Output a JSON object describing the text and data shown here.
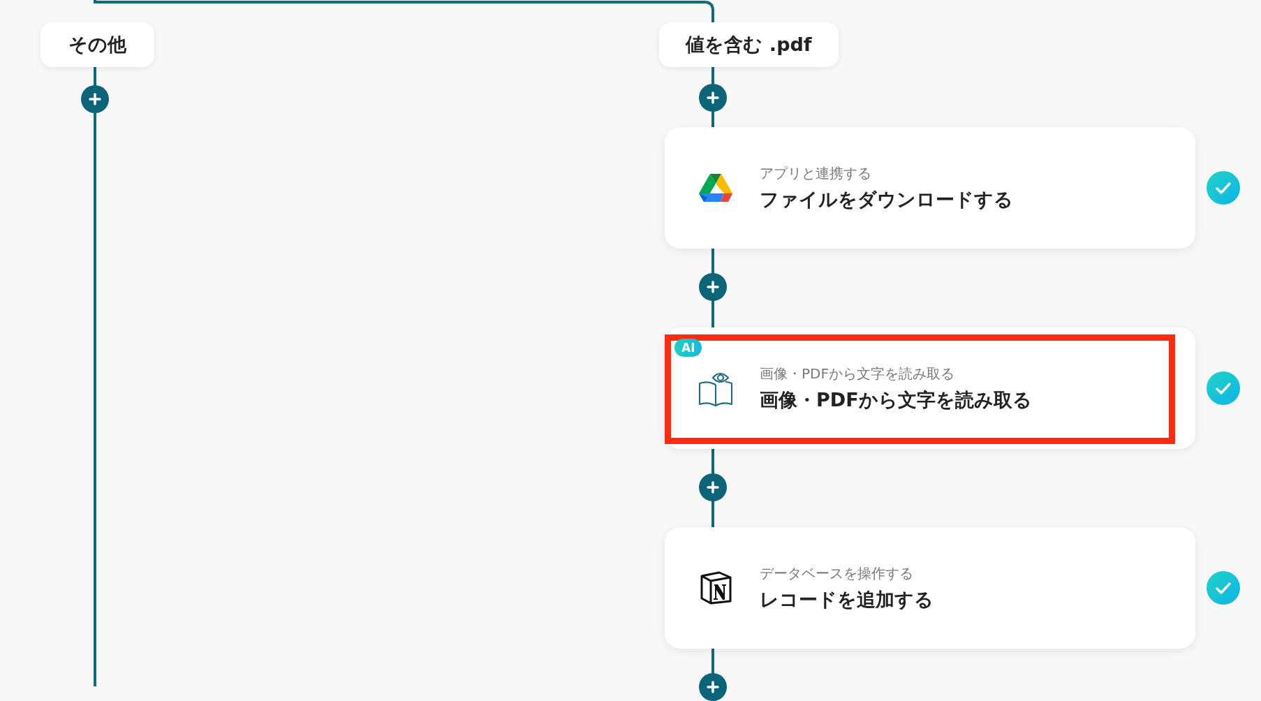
{
  "branches": [
    {
      "label": "その他"
    },
    {
      "label": "値を含む .pdf",
      "steps": [
        {
          "kind": "drive",
          "subtitle": "アプリと連携する",
          "title": "ファイルをダウンロードする",
          "highlighted": false,
          "completed": true
        },
        {
          "kind": "ocr",
          "badge": "AI",
          "subtitle": "画像・PDFから文字を読み取る",
          "title": "画像・PDFから文字を読み取る",
          "highlighted": true,
          "completed": true
        },
        {
          "kind": "notion",
          "subtitle": "データベースを操作する",
          "title": "レコードを追加する",
          "highlighted": false,
          "completed": true
        }
      ]
    }
  ]
}
